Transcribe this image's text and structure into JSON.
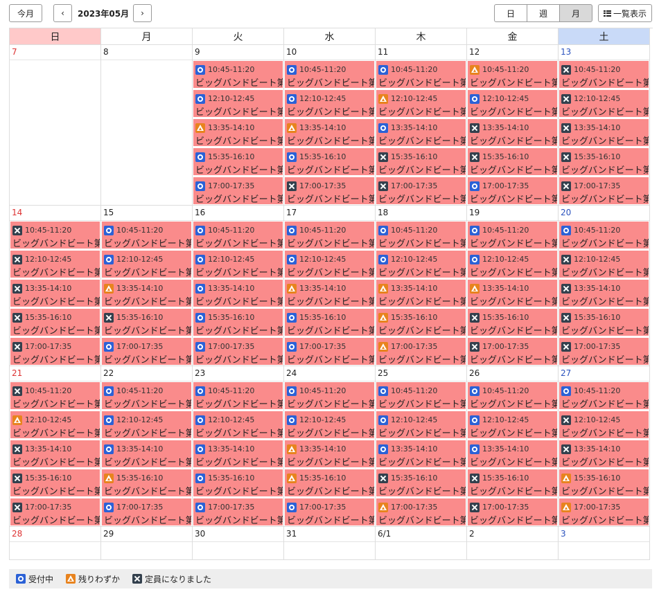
{
  "toolbar": {
    "today_label": "今月",
    "prev_symbol": "‹",
    "next_symbol": "›",
    "month_title": "2023年05月",
    "views": [
      {
        "label": "日",
        "active": false
      },
      {
        "label": "週",
        "active": false
      },
      {
        "label": "月",
        "active": true
      }
    ],
    "list_label": "一覧表示"
  },
  "weekdays": [
    "日",
    "月",
    "火",
    "水",
    "木",
    "金",
    "土"
  ],
  "event_name": "ビッグバンドビート第",
  "slots": [
    "10:45-11:20",
    "12:10-12:45",
    "13:35-14:10",
    "15:35-16:10",
    "17:00-17:35"
  ],
  "weeks": [
    {
      "days": [
        {
          "label": "7",
          "events": []
        },
        {
          "label": "8",
          "events": []
        },
        {
          "label": "9",
          "events": [
            "open",
            "open",
            "few",
            "open",
            "open"
          ]
        },
        {
          "label": "10",
          "events": [
            "open",
            "open",
            "few",
            "open",
            "full"
          ]
        },
        {
          "label": "11",
          "events": [
            "open",
            "few",
            "open",
            "full",
            "full"
          ]
        },
        {
          "label": "12",
          "events": [
            "few",
            "open",
            "full",
            "full",
            "open"
          ]
        },
        {
          "label": "13",
          "events": [
            "full",
            "full",
            "full",
            "full",
            "full"
          ]
        }
      ]
    },
    {
      "days": [
        {
          "label": "14",
          "events": [
            "full",
            "full",
            "full",
            "full",
            "full"
          ]
        },
        {
          "label": "15",
          "events": [
            "open",
            "open",
            "few",
            "full",
            "open"
          ]
        },
        {
          "label": "16",
          "events": [
            "open",
            "open",
            "open",
            "open",
            "open"
          ]
        },
        {
          "label": "17",
          "events": [
            "open",
            "open",
            "few",
            "open",
            "open"
          ]
        },
        {
          "label": "18",
          "events": [
            "open",
            "open",
            "few",
            "few",
            "few"
          ]
        },
        {
          "label": "19",
          "events": [
            "open",
            "open",
            "few",
            "full",
            "full"
          ]
        },
        {
          "label": "20",
          "events": [
            "open",
            "full",
            "full",
            "full",
            "full"
          ]
        }
      ]
    },
    {
      "days": [
        {
          "label": "21",
          "events": [
            "full",
            "few",
            "full",
            "full",
            "full"
          ]
        },
        {
          "label": "22",
          "events": [
            "open",
            "open",
            "open",
            "few",
            "open"
          ]
        },
        {
          "label": "23",
          "events": [
            "open",
            "open",
            "open",
            "open",
            "open"
          ]
        },
        {
          "label": "24",
          "events": [
            "open",
            "open",
            "few",
            "few",
            "open"
          ]
        },
        {
          "label": "25",
          "events": [
            "open",
            "open",
            "open",
            "full",
            "few"
          ]
        },
        {
          "label": "26",
          "events": [
            "open",
            "open",
            "open",
            "full",
            "full"
          ]
        },
        {
          "label": "27",
          "events": [
            "open",
            "full",
            "full",
            "few",
            "few"
          ]
        }
      ]
    },
    {
      "days": [
        {
          "label": "28",
          "events": []
        },
        {
          "label": "29",
          "events": []
        },
        {
          "label": "30",
          "events": []
        },
        {
          "label": "31",
          "events": []
        },
        {
          "label": "6/1",
          "events": []
        },
        {
          "label": "2",
          "events": []
        },
        {
          "label": "3",
          "events": []
        }
      ]
    }
  ],
  "legend": [
    {
      "status": "open",
      "icon": "circle-icon",
      "label": "受付中"
    },
    {
      "status": "few",
      "icon": "triangle-icon",
      "label": "残りわずか"
    },
    {
      "status": "full",
      "icon": "cross-icon",
      "label": "定員になりました"
    }
  ],
  "colors": {
    "event_bg": "#fa8b8b",
    "sunday_header": "#ffc9c9",
    "saturday_header": "#c9daf8",
    "open": "#2b61d6",
    "few": "#e8831e",
    "full": "#33404d"
  }
}
